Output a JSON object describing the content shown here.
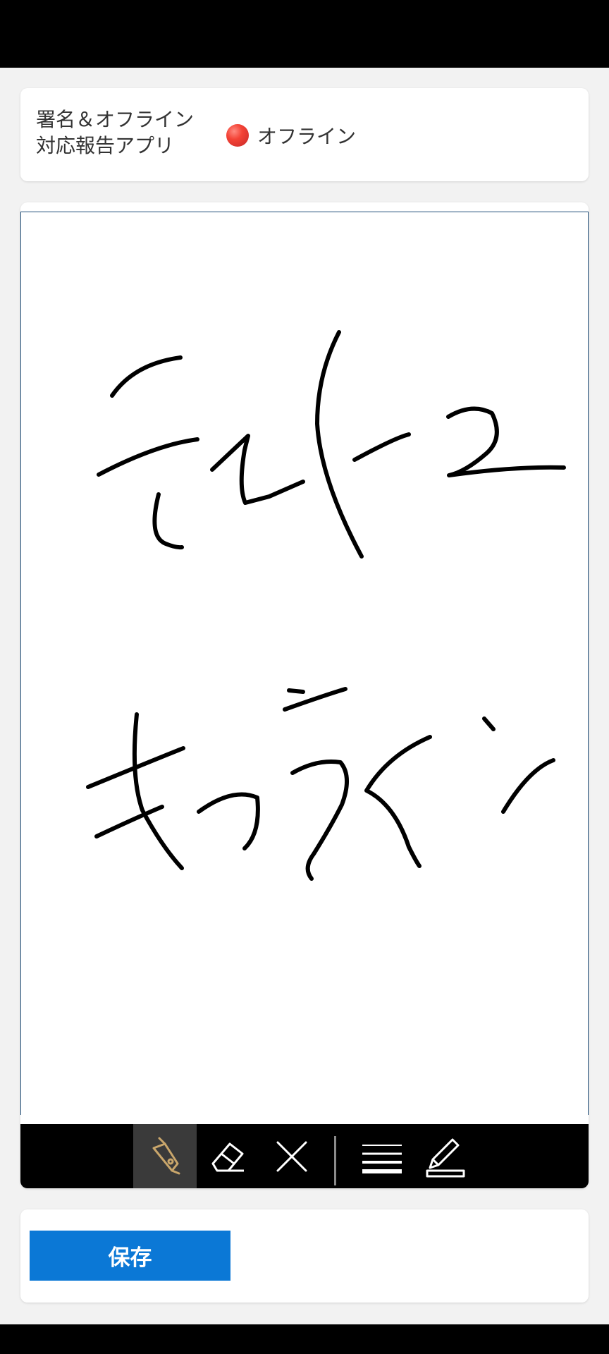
{
  "header": {
    "app_title_line1": "署名＆オフライン",
    "app_title_line2": "対応報告アプリ",
    "status_text": "オフライン",
    "status_color": "#e53935"
  },
  "signature_pad": {
    "handwritten_content": "テスト2 オフライン",
    "ink_color": "#000000",
    "border_color": "#1f4e79"
  },
  "toolbar": {
    "tools": [
      {
        "icon": "fountain-pen-icon",
        "active": true
      },
      {
        "icon": "eraser-icon",
        "active": false
      },
      {
        "icon": "close-icon",
        "active": false
      },
      {
        "icon": "line-width-icon",
        "active": false
      },
      {
        "icon": "edit-square-icon",
        "active": false
      }
    ],
    "active_color": "#c9a66b"
  },
  "actions": {
    "save_label": "保存",
    "save_color": "#0b78d6"
  }
}
